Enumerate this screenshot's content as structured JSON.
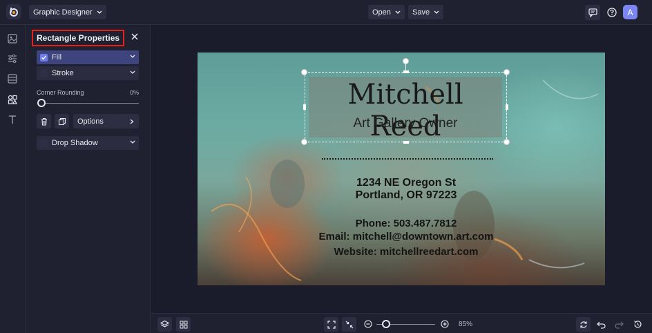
{
  "app": {
    "title": "Graphic Designer",
    "avatar_letter": "A"
  },
  "topbar": {
    "open_label": "Open",
    "save_label": "Save"
  },
  "panel": {
    "title": "Rectangle Properties",
    "fill_label": "Fill",
    "fill_checked": true,
    "stroke_label": "Stroke",
    "stroke_checked": false,
    "corner_label": "Corner Rounding",
    "corner_value": "0%",
    "options_label": "Options",
    "drop_shadow_label": "Drop Shadow",
    "drop_shadow_checked": false
  },
  "card": {
    "name": "Mitchell Reed",
    "subtitle": "Art Gallery Owner",
    "address_line1": "1234 NE Oregon St",
    "address_line2": "Portland, OR 97223",
    "phone": "Phone: 503.487.7812",
    "email": "Email: mitchell@downtown.art.com",
    "website": "Website: mitchellreedart.com"
  },
  "bottombar": {
    "zoom_value": "85%"
  },
  "colors": {
    "accent": "#6e7cf0",
    "highlight_border": "#e0241b",
    "background": "#1b1c2b"
  }
}
